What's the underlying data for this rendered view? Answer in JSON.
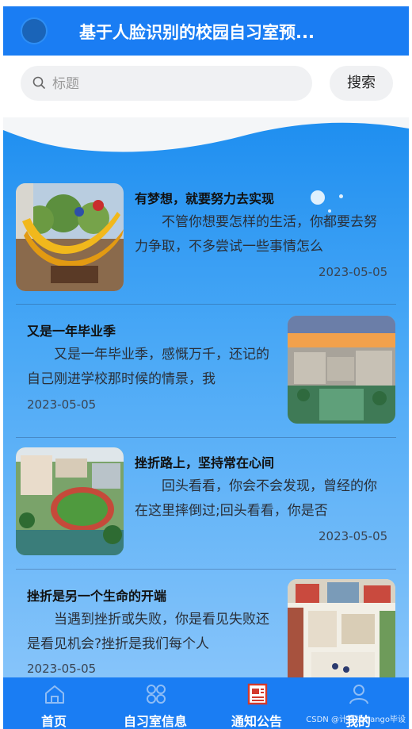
{
  "header": {
    "title": "基于人脸识别的校园自习室预..."
  },
  "search": {
    "placeholder": "标题",
    "value": "",
    "button_label": "搜索"
  },
  "articles": [
    {
      "title": "有梦想，就要努力去实现",
      "excerpt": "不管你想要怎样的生活，你都要去努力争取，不多尝试一些事情怎么",
      "date": "2023-05-05",
      "image_side": "left",
      "image": "sculpture-photo"
    },
    {
      "title": "又是一年毕业季",
      "excerpt": "又是一年毕业季，感慨万千，还记的自己刚进学校那时候的情景，我",
      "date": "2023-05-05",
      "image_side": "right",
      "image": "campus-sunset-photo"
    },
    {
      "title": "挫折路上，坚持常在心间",
      "excerpt": "回头看看，你会不会发现，曾经的你在这里摔倒过;回头看看，你是否",
      "date": "2023-05-05",
      "image_side": "left",
      "image": "campus-aerial-photo"
    },
    {
      "title": "挫折是另一个生命的开端",
      "excerpt": "当遇到挫折或失败，你是看见失败还是看见机会?挫折是我们每个人",
      "date": "2023-05-05",
      "image_side": "right",
      "image": "campus-illustration"
    }
  ],
  "tabbar": {
    "items": [
      {
        "label": "首页",
        "icon": "home-icon"
      },
      {
        "label": "自习室信息",
        "icon": "grid-icon"
      },
      {
        "label": "通知公告",
        "icon": "news-icon"
      },
      {
        "label": "我的",
        "icon": "user-icon"
      }
    ],
    "active_index": 2
  },
  "watermark": "CSDN @计算机django毕设",
  "colors": {
    "primary": "#1a7df3",
    "gradient_top": "#1e8ef0",
    "gradient_bottom": "#86c4fa",
    "active_icon": "#d33a2c"
  }
}
